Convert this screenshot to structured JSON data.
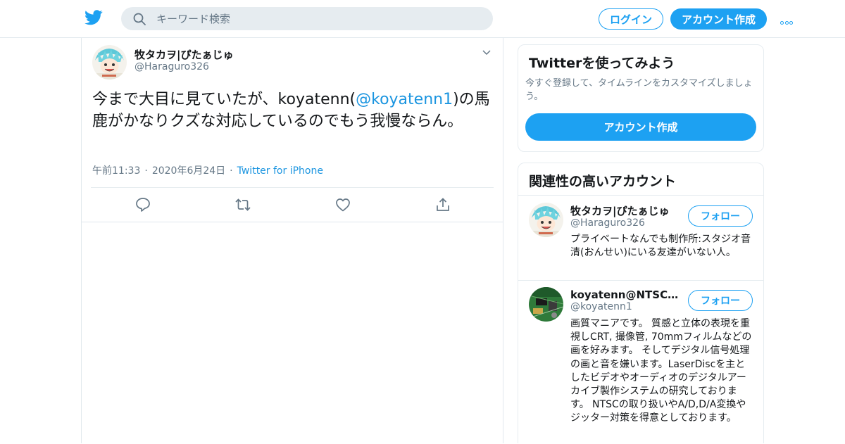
{
  "header": {
    "search_placeholder": "キーワード検索",
    "login_label": "ログイン",
    "signup_label": "アカウント作成"
  },
  "tweet": {
    "display_name": "牧タカヲ|ぴたぁじゅ",
    "handle": "@Haraguro326",
    "text_before": "今まで大目に見ていたが、koyatenn(",
    "mention": "@koyatenn1",
    "text_after": ")の馬鹿がかなりクズな対応しているのでもう我慢ならん。",
    "time": "午前11:33",
    "date": "2020年6月24日",
    "source": "Twitter for iPhone"
  },
  "sidebar": {
    "promo": {
      "title": "Twitterを使ってみよう",
      "subtitle": "今すぐ登録して、タイムラインをカスタマイズしましょう。",
      "cta_label": "アカウント作成"
    },
    "related": {
      "title": "関連性の高いアカウント",
      "follow_label": "フォロー",
      "accounts": [
        {
          "name": "牧タカヲ|ぴたぁじゅ",
          "handle": "@Haraguro326",
          "bio": "プライベートなんでも制作所:スタジオ音清(おんせい)にいる友達がいない人。"
        },
        {
          "name": "koyatenn@NTSCの...",
          "handle": "@koyatenn1",
          "bio": "画質マニアです。 質感と立体の表現を重視しCRT, 撮像管, 70mmフィルムなどの画を好みます。 そしてデジタル信号処理の画と音を嫌います。LaserDiscを主としたビデオやオーディオのデジタルアーカイブ製作システムの研究しております。 NTSCの取り扱いやA/D,D/A変換やジッター対策を得意としております。"
        }
      ]
    }
  },
  "icons": {
    "logo": "twitter-bird-icon",
    "search": "search-icon",
    "more": "more-dots-icon",
    "caret": "chevron-down-icon",
    "reply": "reply-icon",
    "retweet": "retweet-icon",
    "like": "heart-icon",
    "share": "share-icon"
  },
  "colors": {
    "accent": "#1da1f2",
    "link": "#1b95e0",
    "muted": "#657786",
    "border": "#e1e8ed",
    "search_bg": "#e6ecf0"
  }
}
